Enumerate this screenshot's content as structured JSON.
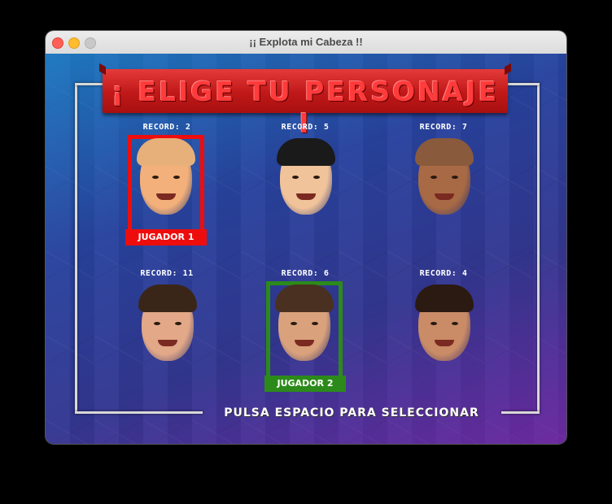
{
  "window": {
    "title": "¡¡ Explota mi Cabeza !!"
  },
  "banner": {
    "text": "¡ ELIGE TU PERSONAJE !"
  },
  "characters": [
    {
      "record": "RECORD: 2",
      "hair": "#e7b07a",
      "skin": "#f3b07a"
    },
    {
      "record": "RECORD: 5",
      "hair": "#1a1a1a",
      "skin": "#f0c39a"
    },
    {
      "record": "RECORD: 7",
      "hair": "#8a5a3c",
      "skin": "#a86a44"
    },
    {
      "record": "RECORD: 11",
      "hair": "#3a2618",
      "skin": "#e2a888"
    },
    {
      "record": "RECORD: 6",
      "hair": "#4a3020",
      "skin": "#d9a27c"
    },
    {
      "record": "RECORD: 4",
      "hair": "#2a1a12",
      "skin": "#c98c66"
    }
  ],
  "player1": {
    "label": "JUGADOR 1",
    "color": "#ee0d0d"
  },
  "player2": {
    "label": "JUGADOR 2",
    "color": "#2c8a1a"
  },
  "prompt": "PULSA ESPACIO PARA SELECCIONAR"
}
